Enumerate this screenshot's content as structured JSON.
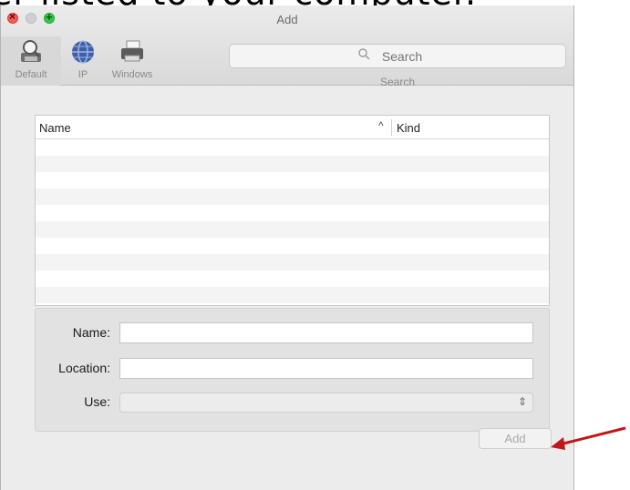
{
  "background_text": "er listed to your computer.",
  "window": {
    "title": "Add"
  },
  "toolbar": {
    "items": [
      {
        "label": "Default",
        "icon": "default-printer-icon",
        "selected": true
      },
      {
        "label": "IP",
        "icon": "globe-icon",
        "selected": false
      },
      {
        "label": "Windows",
        "icon": "windows-printer-icon",
        "selected": false
      }
    ],
    "search": {
      "placeholder": "Search",
      "caption": "Search"
    }
  },
  "printer_list": {
    "columns": [
      "Name",
      "Kind"
    ],
    "sort_indicator": "^",
    "rows": []
  },
  "form": {
    "name_label": "Name:",
    "name_value": "",
    "location_label": "Location:",
    "location_value": "",
    "use_label": "Use:",
    "use_value": ""
  },
  "actions": {
    "add_label": "Add"
  },
  "colors": {
    "close": "#fc5753",
    "minimize": "#d0d0d0",
    "maximize": "#33c748",
    "annotation_arrow": "#c0171a"
  }
}
